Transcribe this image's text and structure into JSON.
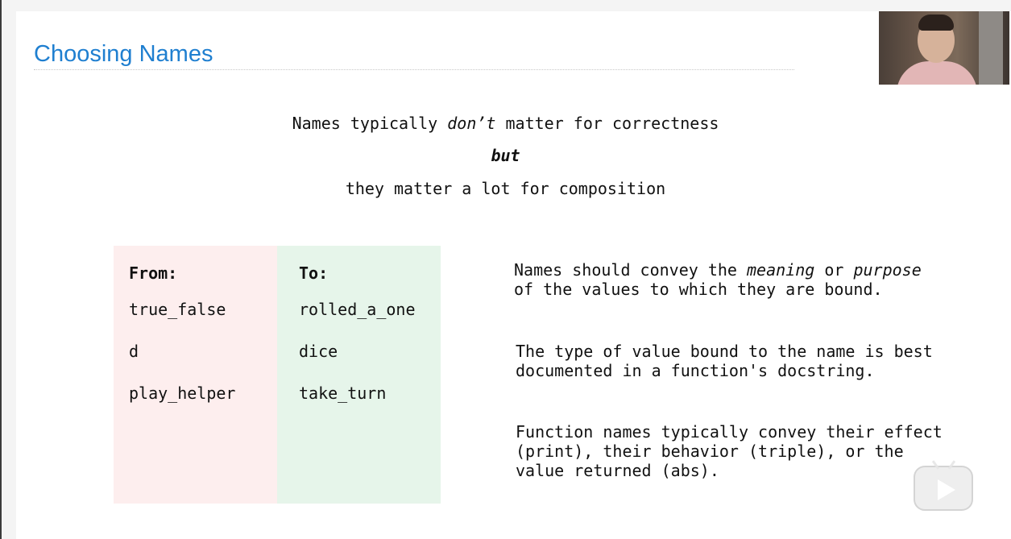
{
  "slide": {
    "title": "Choosing Names",
    "line1_pre": "Names typically ",
    "line1_em": "don’t",
    "line1_post": " matter for correctness",
    "line2": "but",
    "line3": "they matter a lot for composition"
  },
  "table": {
    "from_header": "From:",
    "to_header": "To:",
    "rows": [
      {
        "from": "true_false",
        "to": "rolled_a_one"
      },
      {
        "from": "d",
        "to": "dice"
      },
      {
        "from": "play_helper",
        "to": "take_turn"
      }
    ]
  },
  "notes": {
    "n1_a": "Names should convey the ",
    "n1_meaning": "meaning",
    "n1_or": " or ",
    "n1_purpose": "purpose",
    "n1_line2": "of the values to which they are bound.",
    "n2_line1": "The type of value bound to the name is best",
    "n2_line2": "documented in a function's docstring.",
    "n3_line1": "Function names typically convey their effect",
    "n3_line2": "(print), their behavior (triple), or the",
    "n3_line3": "value returned (abs)."
  },
  "colors": {
    "title": "#1f7fd0",
    "from_bg": "#fdeeee",
    "to_bg": "#e6f5ea"
  },
  "icons": {
    "play": "play-icon",
    "webcam": "webcam-feed"
  }
}
